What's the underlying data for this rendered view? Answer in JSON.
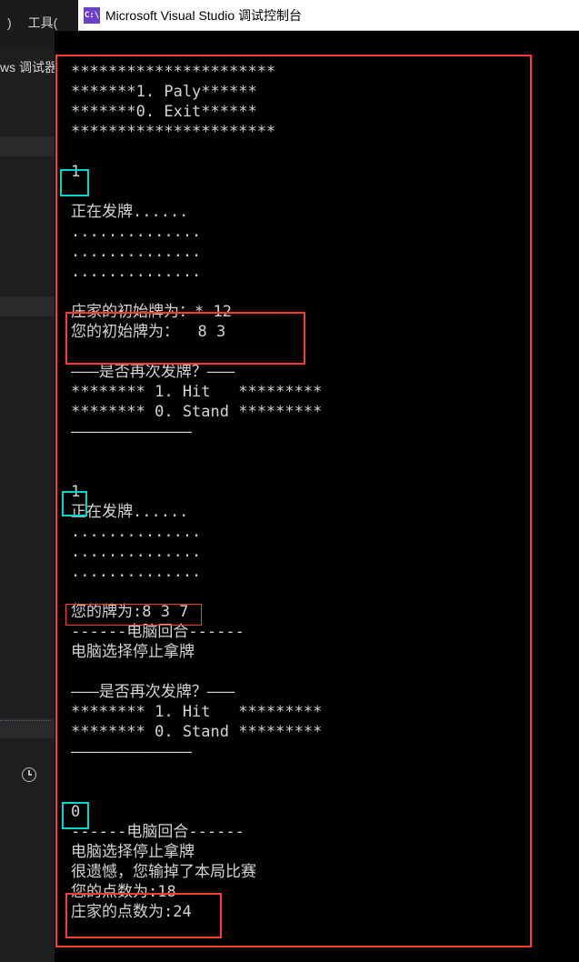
{
  "vs": {
    "paren_char": ")",
    "menu_tools": "工具(",
    "debugger_label": "ws 调试器"
  },
  "titlebar": {
    "icon_text": "C:\\",
    "title": "Microsoft Visual Studio 调试控制台"
  },
  "console": {
    "lines": [
      "**********************",
      "*******1. Paly******",
      "*******0. Exit******",
      "**********************",
      "",
      "1",
      "",
      "正在发牌......",
      "..............",
      "..............",
      "..............",
      "",
      "庄家的初始牌为：* 12",
      "您的初始牌为：  8 3",
      "",
      "———是否再次发牌？———",
      "******** 1. Hit   *********",
      "******** 0. Stand *********",
      "—————————————",
      "",
      "",
      "1",
      "正在发牌......",
      "..............",
      "..............",
      "..............",
      "",
      "您的牌为:8 3 7",
      "------电脑回合------",
      "电脑选择停止拿牌",
      "",
      "———是否再次发牌？———",
      "******** 1. Hit   *********",
      "******** 0. Stand *********",
      "—————————————",
      "",
      "",
      "0",
      "------电脑回合------",
      "电脑选择停止拿牌",
      "很遗憾，您输掉了本局比赛",
      "您的点数为:18",
      "庄家的点数为:24"
    ]
  },
  "game_data": {
    "menu_options": [
      {
        "key": "1",
        "label": "Paly"
      },
      {
        "key": "0",
        "label": "Exit"
      }
    ],
    "user_inputs": [
      "1",
      "1",
      "0"
    ],
    "dealer_initial_hand": [
      "*",
      "12"
    ],
    "player_initial_hand": [
      "8",
      "3"
    ],
    "player_hand_after_hit": [
      "8",
      "3",
      "7"
    ],
    "hit_stand_options": [
      {
        "key": "1",
        "label": "Hit"
      },
      {
        "key": "0",
        "label": "Stand"
      }
    ],
    "computer_choice_text": "电脑选择停止拿牌",
    "result_text": "很遗憾，您输掉了本局比赛",
    "player_score": 18,
    "dealer_score": 24
  }
}
